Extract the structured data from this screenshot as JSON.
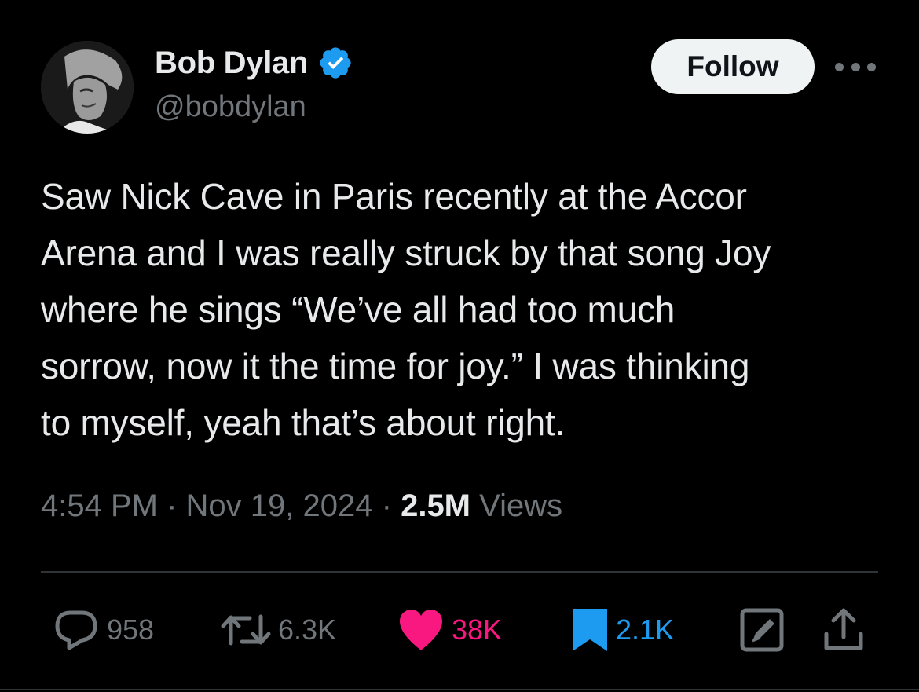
{
  "author": {
    "display_name": "Bob Dylan",
    "handle": "@bobdylan",
    "verified": true
  },
  "follow_label": "Follow",
  "tweet": {
    "lines": [
      "Saw Nick Cave in Paris recently at the Accor",
      "Arena and I was really struck by that song Joy",
      "where he sings “We’ve all had too much",
      "sorrow, now it the time for joy.” I was thinking",
      "to myself, yeah that’s about right."
    ],
    "time": "4:54 PM",
    "separator": "·",
    "date": "Nov 19, 2024",
    "views_count": "2.5M",
    "views_label": "Views"
  },
  "actions": {
    "replies": "958",
    "reposts": "6.3K",
    "likes": "38K",
    "bookmarks": "2.1K"
  },
  "colors": {
    "background": "#000000",
    "text_primary": "#e7e9ea",
    "text_secondary": "#71767b",
    "like": "#f91880",
    "bookmark": "#1d9bf0",
    "verified": "#1d9bf0",
    "follow_bg": "#eff3f4"
  },
  "icons": {
    "verified": "verified-badge-icon",
    "more": "more-options-icon",
    "reply": "reply-icon",
    "repost": "repost-icon",
    "like": "heart-icon",
    "bookmark": "bookmark-icon",
    "edit": "edit-icon",
    "share": "share-icon"
  }
}
